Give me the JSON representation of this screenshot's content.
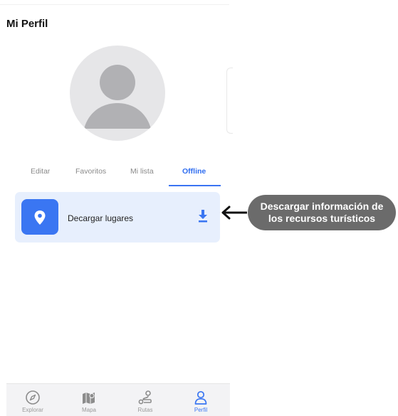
{
  "profile": {
    "title": "Mi Perfil"
  },
  "tabs": [
    {
      "label": "Editar"
    },
    {
      "label": "Favoritos"
    },
    {
      "label": "Mi lista"
    },
    {
      "label": "Offline",
      "active": true
    }
  ],
  "offline": {
    "item_label": "Decargar lugares",
    "pin_icon": "map-pin-icon",
    "download_icon": "download-icon"
  },
  "annotation": {
    "line1": "Descargar información de",
    "line2": "los recursos turísticos"
  },
  "bottom_nav": [
    {
      "label": "Explorar",
      "icon": "compass-icon"
    },
    {
      "label": "Mapa",
      "icon": "map-icon"
    },
    {
      "label": "Rutas",
      "icon": "route-icon"
    },
    {
      "label": "Perfil",
      "icon": "user-icon",
      "active": true
    }
  ],
  "colors": {
    "accent": "#3a76f2",
    "card_bg": "#e7effd",
    "callout_bg": "#6b6b6b"
  }
}
